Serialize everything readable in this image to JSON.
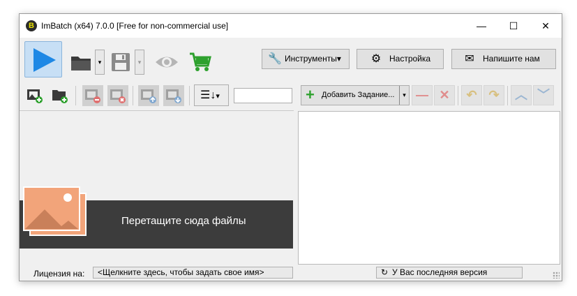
{
  "window": {
    "title": "ImBatch (x64) 7.0.0 [Free for non-commercial use]",
    "min_glyph": "—",
    "max_glyph": "☐",
    "close_glyph": "✕"
  },
  "toolbar": {
    "tools_label": "Инструменты",
    "settings_label": "Настройка",
    "write_label": "Напишите нам",
    "dropdown_glyph": "▾"
  },
  "files_toolbar": {
    "sort_glyph": "↓",
    "filter_value": ""
  },
  "tasks_toolbar": {
    "add_task_label": "Добавить Задание...",
    "remove_glyph": "—",
    "clear_glyph": "✕"
  },
  "drop_area": {
    "text": "Перетащите сюда файлы"
  },
  "status": {
    "license_label": "Лицензия на:",
    "license_value": "<Щелкните здесь, чтобы задать свое имя>",
    "version_text": "У Вас последняя версия"
  },
  "colors": {
    "play_blue": "#1e88e5",
    "cart_green": "#2ea12e",
    "photo_orange": "#f2a47a",
    "banner_dark": "#3c3c3c"
  }
}
